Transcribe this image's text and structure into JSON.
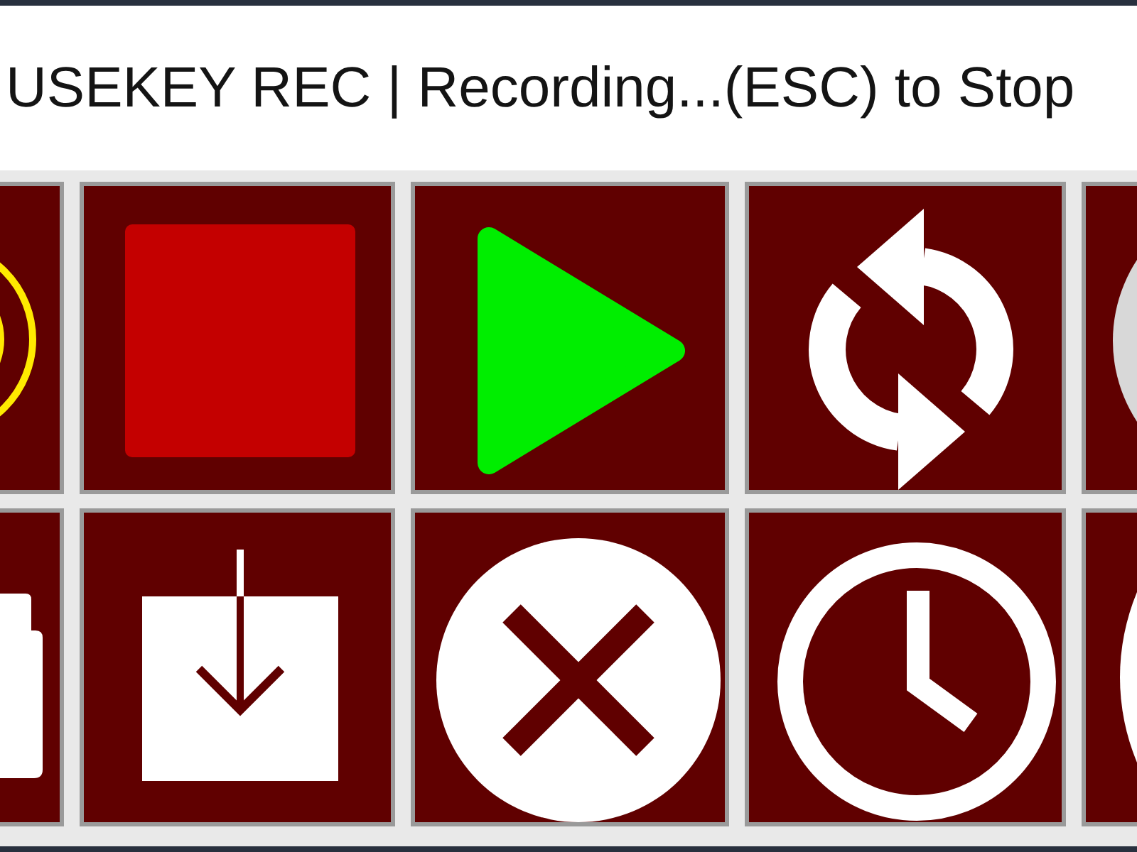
{
  "window": {
    "title": "USEKEY REC | Recording...(ESC) to Stop"
  },
  "toolbar": {
    "rows": [
      {
        "buttons": [
          {
            "kind": "ring"
          },
          {
            "kind": "stop"
          },
          {
            "kind": "play"
          },
          {
            "kind": "repeat"
          },
          {
            "kind": "disc"
          }
        ]
      },
      {
        "buttons": [
          {
            "kind": "folder"
          },
          {
            "kind": "download"
          },
          {
            "kind": "close"
          },
          {
            "kind": "clock"
          },
          {
            "kind": "circle"
          }
        ]
      }
    ]
  }
}
